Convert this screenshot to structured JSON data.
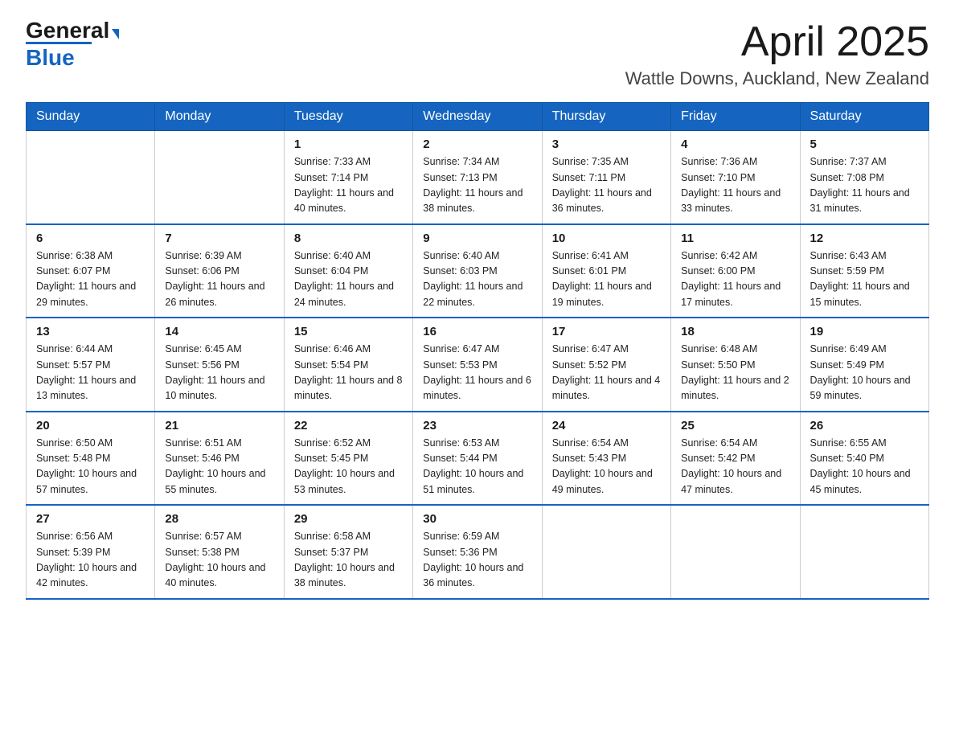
{
  "header": {
    "logo_general": "General",
    "logo_blue": "Blue",
    "month_title": "April 2025",
    "location": "Wattle Downs, Auckland, New Zealand"
  },
  "days_of_week": [
    "Sunday",
    "Monday",
    "Tuesday",
    "Wednesday",
    "Thursday",
    "Friday",
    "Saturday"
  ],
  "weeks": [
    [
      {
        "day": "",
        "info": ""
      },
      {
        "day": "",
        "info": ""
      },
      {
        "day": "1",
        "info": "Sunrise: 7:33 AM\nSunset: 7:14 PM\nDaylight: 11 hours\nand 40 minutes."
      },
      {
        "day": "2",
        "info": "Sunrise: 7:34 AM\nSunset: 7:13 PM\nDaylight: 11 hours\nand 38 minutes."
      },
      {
        "day": "3",
        "info": "Sunrise: 7:35 AM\nSunset: 7:11 PM\nDaylight: 11 hours\nand 36 minutes."
      },
      {
        "day": "4",
        "info": "Sunrise: 7:36 AM\nSunset: 7:10 PM\nDaylight: 11 hours\nand 33 minutes."
      },
      {
        "day": "5",
        "info": "Sunrise: 7:37 AM\nSunset: 7:08 PM\nDaylight: 11 hours\nand 31 minutes."
      }
    ],
    [
      {
        "day": "6",
        "info": "Sunrise: 6:38 AM\nSunset: 6:07 PM\nDaylight: 11 hours\nand 29 minutes."
      },
      {
        "day": "7",
        "info": "Sunrise: 6:39 AM\nSunset: 6:06 PM\nDaylight: 11 hours\nand 26 minutes."
      },
      {
        "day": "8",
        "info": "Sunrise: 6:40 AM\nSunset: 6:04 PM\nDaylight: 11 hours\nand 24 minutes."
      },
      {
        "day": "9",
        "info": "Sunrise: 6:40 AM\nSunset: 6:03 PM\nDaylight: 11 hours\nand 22 minutes."
      },
      {
        "day": "10",
        "info": "Sunrise: 6:41 AM\nSunset: 6:01 PM\nDaylight: 11 hours\nand 19 minutes."
      },
      {
        "day": "11",
        "info": "Sunrise: 6:42 AM\nSunset: 6:00 PM\nDaylight: 11 hours\nand 17 minutes."
      },
      {
        "day": "12",
        "info": "Sunrise: 6:43 AM\nSunset: 5:59 PM\nDaylight: 11 hours\nand 15 minutes."
      }
    ],
    [
      {
        "day": "13",
        "info": "Sunrise: 6:44 AM\nSunset: 5:57 PM\nDaylight: 11 hours\nand 13 minutes."
      },
      {
        "day": "14",
        "info": "Sunrise: 6:45 AM\nSunset: 5:56 PM\nDaylight: 11 hours\nand 10 minutes."
      },
      {
        "day": "15",
        "info": "Sunrise: 6:46 AM\nSunset: 5:54 PM\nDaylight: 11 hours\nand 8 minutes."
      },
      {
        "day": "16",
        "info": "Sunrise: 6:47 AM\nSunset: 5:53 PM\nDaylight: 11 hours\nand 6 minutes."
      },
      {
        "day": "17",
        "info": "Sunrise: 6:47 AM\nSunset: 5:52 PM\nDaylight: 11 hours\nand 4 minutes."
      },
      {
        "day": "18",
        "info": "Sunrise: 6:48 AM\nSunset: 5:50 PM\nDaylight: 11 hours\nand 2 minutes."
      },
      {
        "day": "19",
        "info": "Sunrise: 6:49 AM\nSunset: 5:49 PM\nDaylight: 10 hours\nand 59 minutes."
      }
    ],
    [
      {
        "day": "20",
        "info": "Sunrise: 6:50 AM\nSunset: 5:48 PM\nDaylight: 10 hours\nand 57 minutes."
      },
      {
        "day": "21",
        "info": "Sunrise: 6:51 AM\nSunset: 5:46 PM\nDaylight: 10 hours\nand 55 minutes."
      },
      {
        "day": "22",
        "info": "Sunrise: 6:52 AM\nSunset: 5:45 PM\nDaylight: 10 hours\nand 53 minutes."
      },
      {
        "day": "23",
        "info": "Sunrise: 6:53 AM\nSunset: 5:44 PM\nDaylight: 10 hours\nand 51 minutes."
      },
      {
        "day": "24",
        "info": "Sunrise: 6:54 AM\nSunset: 5:43 PM\nDaylight: 10 hours\nand 49 minutes."
      },
      {
        "day": "25",
        "info": "Sunrise: 6:54 AM\nSunset: 5:42 PM\nDaylight: 10 hours\nand 47 minutes."
      },
      {
        "day": "26",
        "info": "Sunrise: 6:55 AM\nSunset: 5:40 PM\nDaylight: 10 hours\nand 45 minutes."
      }
    ],
    [
      {
        "day": "27",
        "info": "Sunrise: 6:56 AM\nSunset: 5:39 PM\nDaylight: 10 hours\nand 42 minutes."
      },
      {
        "day": "28",
        "info": "Sunrise: 6:57 AM\nSunset: 5:38 PM\nDaylight: 10 hours\nand 40 minutes."
      },
      {
        "day": "29",
        "info": "Sunrise: 6:58 AM\nSunset: 5:37 PM\nDaylight: 10 hours\nand 38 minutes."
      },
      {
        "day": "30",
        "info": "Sunrise: 6:59 AM\nSunset: 5:36 PM\nDaylight: 10 hours\nand 36 minutes."
      },
      {
        "day": "",
        "info": ""
      },
      {
        "day": "",
        "info": ""
      },
      {
        "day": "",
        "info": ""
      }
    ]
  ]
}
